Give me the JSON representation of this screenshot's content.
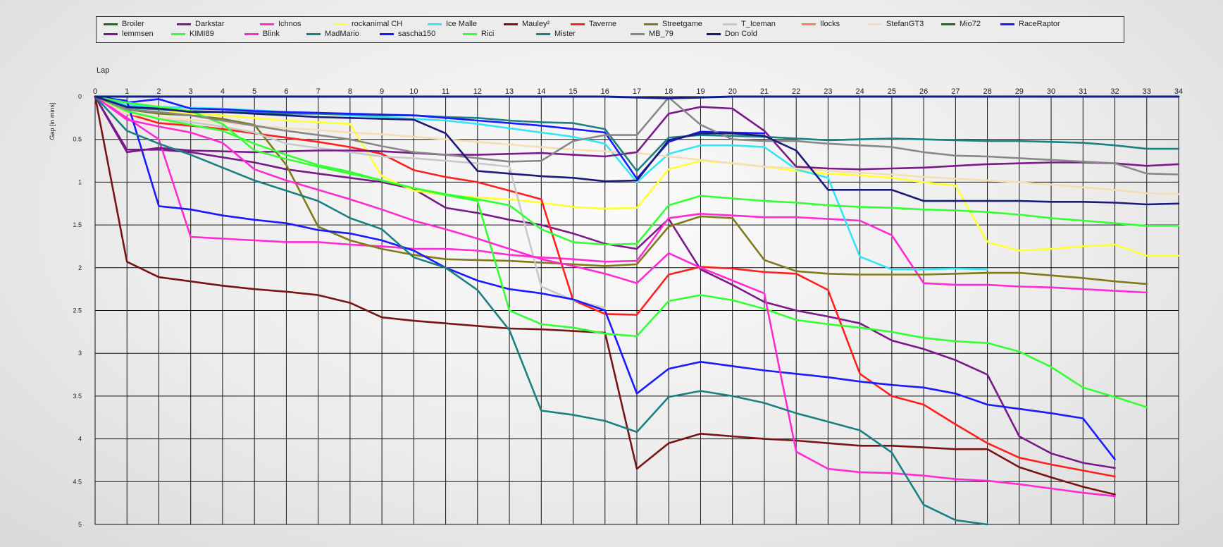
{
  "chart_data": {
    "type": "line",
    "xlabel": "Lap",
    "ylabel": "Gap [in mins]",
    "x": [
      0,
      1,
      2,
      3,
      4,
      5,
      6,
      7,
      8,
      9,
      10,
      11,
      12,
      13,
      14,
      15,
      16,
      17,
      18,
      19,
      20,
      21,
      22,
      23,
      24,
      25,
      26,
      27,
      28,
      29,
      30,
      31,
      32,
      33,
      34
    ],
    "xlim": [
      0,
      34
    ],
    "ylim": [
      0,
      5
    ],
    "y_inverted": true,
    "y_ticks": [
      0,
      0.5,
      1,
      1.5,
      2,
      2.5,
      3,
      3.5,
      4,
      4.5,
      5
    ],
    "grid": true,
    "legend_position": "top",
    "series": [
      {
        "name": "Broiler",
        "color": "#1a6b1a",
        "values": [
          0
        ]
      },
      {
        "name": "Darkstar",
        "color": "#7a1a8a",
        "values": [
          0,
          0.62,
          0.62,
          0.65,
          0.71,
          0.77,
          0.85,
          0.9,
          0.95,
          1.0,
          1.08,
          1.3,
          1.36,
          1.44,
          1.5,
          1.6,
          1.72,
          1.78,
          1.43,
          2.02,
          2.2,
          2.4,
          2.5,
          2.57,
          2.65,
          2.85,
          2.95,
          3.08,
          3.25,
          3.97,
          4.17,
          4.28,
          4.34
        ]
      },
      {
        "name": "Ichnos",
        "color": "#ff2ad4",
        "values": [
          0,
          0.25,
          0.5,
          1.64,
          1.66,
          1.68,
          1.7,
          1.7,
          1.73,
          1.75,
          1.78,
          1.78,
          1.8,
          1.85,
          1.88,
          1.9,
          1.93,
          1.92,
          1.42,
          1.37,
          1.39,
          1.41,
          1.41,
          1.43,
          1.45,
          1.62,
          2.18,
          2.2,
          2.2,
          2.22,
          2.23,
          2.25,
          2.27,
          2.29
        ]
      },
      {
        "name": "rockanimal CH",
        "color": "#ffff33",
        "values": [
          0,
          0.12,
          0.15,
          0.2,
          0.22,
          0.25,
          0.28,
          0.3,
          0.32,
          0.93,
          1.1,
          1.15,
          1.18,
          1.2,
          1.24,
          1.29,
          1.31,
          1.3,
          0.85,
          0.75,
          0.78,
          0.82,
          0.87,
          0.9,
          0.92,
          0.95,
          1.0,
          1.04,
          1.7,
          1.8,
          1.78,
          1.75,
          1.73,
          1.86,
          1.86
        ]
      },
      {
        "name": "Ice Malle",
        "color": "#33e5f5",
        "values": [
          0,
          0.1,
          0.12,
          0.13,
          0.14,
          0.16,
          0.18,
          0.2,
          0.22,
          0.24,
          0.26,
          0.28,
          0.32,
          0.37,
          0.42,
          0.47,
          0.55,
          1.0,
          0.67,
          0.57,
          0.57,
          0.59,
          0.85,
          0.95,
          1.87,
          2.02,
          2.02,
          2.01,
          2.02
        ]
      },
      {
        "name": "Mauley²",
        "color": "#7a1414",
        "values": [
          0,
          1.93,
          2.11,
          2.16,
          2.21,
          2.25,
          2.28,
          2.32,
          2.41,
          2.58,
          2.62,
          2.65,
          2.68,
          2.71,
          2.72,
          2.74,
          2.76,
          4.35,
          4.05,
          3.94,
          3.97,
          4.0,
          4.02,
          4.05,
          4.08,
          4.08,
          4.1,
          4.12,
          4.12,
          4.33,
          4.45,
          4.56,
          4.65
        ]
      },
      {
        "name": "Taverne",
        "color": "#ff1f1f",
        "values": [
          0,
          0.2,
          0.31,
          0.34,
          0.38,
          0.43,
          0.48,
          0.53,
          0.59,
          0.67,
          0.86,
          0.94,
          1.0,
          1.1,
          1.2,
          2.38,
          2.54,
          2.55,
          2.08,
          1.99,
          2.01,
          2.05,
          2.07,
          2.26,
          3.24,
          3.5,
          3.6,
          3.83,
          4.05,
          4.22,
          4.3,
          4.37,
          4.44
        ]
      },
      {
        "name": "Streetgame",
        "color": "#807a1a",
        "values": [
          0,
          0.15,
          0.2,
          0.22,
          0.26,
          0.33,
          0.8,
          1.52,
          1.68,
          1.78,
          1.85,
          1.9,
          1.91,
          1.92,
          1.94,
          1.96,
          1.98,
          1.96,
          1.52,
          1.4,
          1.42,
          1.91,
          2.04,
          2.07,
          2.08,
          2.08,
          2.08,
          2.07,
          2.06,
          2.06,
          2.09,
          2.12,
          2.16,
          2.19
        ]
      },
      {
        "name": "T_Iceman",
        "color": "#c8c8c8",
        "values": [
          0,
          0.18,
          0.25,
          0.3,
          0.35,
          0.42,
          0.55,
          0.6,
          0.65,
          0.7,
          0.72,
          0.75,
          0.78,
          0.82,
          2.22,
          2.38,
          2.47
        ]
      },
      {
        "name": "Ilocks",
        "color": "#ff7a5a",
        "values": [
          0
        ]
      },
      {
        "name": "StefanGT3",
        "color": "#f5deb3",
        "values": [
          0,
          0.2,
          0.25,
          0.27,
          0.3,
          0.34,
          0.37,
          0.39,
          0.42,
          0.44,
          0.47,
          0.5,
          0.53,
          0.56,
          0.59,
          0.62,
          0.64,
          0.66,
          0.7,
          0.74,
          0.78,
          0.82,
          0.84,
          0.87,
          0.89,
          0.91,
          0.94,
          0.96,
          0.98,
          1.0,
          1.03,
          1.06,
          1.09,
          1.13,
          1.14
        ]
      },
      {
        "name": "Mio72",
        "color": "#1a6b1a",
        "values": [
          0
        ]
      },
      {
        "name": "RaceRaptor",
        "color": "#1a1aff",
        "values": [
          0,
          0.05,
          1.28,
          1.32,
          1.39,
          1.44,
          1.48,
          1.56,
          1.6,
          1.68,
          1.8,
          2.0,
          2.15,
          2.25,
          2.3,
          2.37,
          2.5,
          3.47,
          3.18,
          3.1,
          3.15,
          3.2,
          3.24,
          3.28,
          3.33,
          3.37,
          3.4,
          3.47,
          3.6,
          3.65,
          3.7,
          3.76,
          4.24
        ]
      },
      {
        "name": "lemmsen",
        "color": "#7a1a8a",
        "values": [
          0,
          0.65,
          0.6,
          0.63,
          0.64,
          0.65,
          0.64,
          0.63,
          0.63,
          0.64,
          0.66,
          0.68,
          0.68,
          0.67,
          0.66,
          0.68,
          0.7,
          0.65,
          0.2,
          0.12,
          0.14,
          0.4,
          0.82,
          0.84,
          0.85,
          0.84,
          0.83,
          0.81,
          0.79,
          0.78,
          0.77,
          0.77,
          0.78,
          0.81,
          0.79
        ]
      },
      {
        "name": "KIMI89",
        "color": "#33ff33",
        "values": [
          0,
          0.17,
          0.26,
          0.33,
          0.4,
          0.55,
          0.68,
          0.8,
          0.88,
          0.98,
          1.07,
          1.15,
          1.22,
          2.5,
          2.66,
          2.7,
          2.77,
          2.8,
          2.39,
          2.32,
          2.38,
          2.48,
          2.61,
          2.66,
          2.7,
          2.75,
          2.82,
          2.86,
          2.88,
          2.98,
          3.16,
          3.4,
          3.51,
          3.63
        ]
      },
      {
        "name": "Blink",
        "color": "#ff2ad4",
        "values": [
          0,
          0.27,
          0.35,
          0.42,
          0.54,
          0.85,
          0.98,
          1.09,
          1.2,
          1.32,
          1.45,
          1.55,
          1.66,
          1.78,
          1.9,
          1.98,
          2.07,
          2.18,
          1.83,
          2.0,
          2.15,
          2.3,
          4.15,
          4.35,
          4.39,
          4.4,
          4.43,
          4.47,
          4.49,
          4.53,
          4.58,
          4.63,
          4.67
        ]
      },
      {
        "name": "MadMario",
        "color": "#1a8080",
        "values": [
          0,
          0.13,
          0.15,
          0.17,
          0.18,
          0.19,
          0.2,
          0.2,
          0.21,
          0.22,
          0.22,
          0.24,
          0.25,
          0.28,
          0.3,
          0.31,
          0.38,
          0.87,
          0.48,
          0.45,
          0.46,
          0.47,
          0.49,
          0.51,
          0.5,
          0.49,
          0.5,
          0.51,
          0.52,
          0.52,
          0.53,
          0.54,
          0.57,
          0.61,
          0.61
        ]
      },
      {
        "name": "sascha150",
        "color": "#1a1aff",
        "values": [
          0,
          0.07,
          0.03,
          0.14,
          0.15,
          0.17,
          0.18,
          0.19,
          0.2,
          0.21,
          0.22,
          0.25,
          0.28,
          0.31,
          0.34,
          0.38,
          0.42,
          0.96,
          0.53,
          0.41,
          0.42,
          0.43
        ]
      },
      {
        "name": "Rici",
        "color": "#33ff33",
        "values": [
          0,
          0.07,
          0.12,
          0.17,
          0.32,
          0.63,
          0.73,
          0.82,
          0.9,
          0.98,
          1.07,
          1.14,
          1.2,
          1.27,
          1.55,
          1.7,
          1.73,
          1.72,
          1.27,
          1.16,
          1.19,
          1.22,
          1.24,
          1.27,
          1.29,
          1.3,
          1.32,
          1.33,
          1.35,
          1.38,
          1.42,
          1.45,
          1.48,
          1.51,
          1.51
        ]
      },
      {
        "name": "Mister",
        "color": "#1a8080",
        "values": [
          0,
          0.4,
          0.55,
          0.68,
          0.83,
          0.98,
          1.1,
          1.22,
          1.42,
          1.55,
          1.88,
          2.0,
          2.26,
          2.73,
          3.67,
          3.72,
          3.79,
          3.92,
          3.51,
          3.44,
          3.5,
          3.58,
          3.7,
          3.8,
          3.9,
          4.16,
          4.77,
          4.95,
          5.0
        ]
      },
      {
        "name": "MB_79",
        "color": "#888888",
        "values": [
          0,
          0.15,
          0.18,
          0.22,
          0.28,
          0.34,
          0.4,
          0.45,
          0.5,
          0.58,
          0.65,
          0.68,
          0.72,
          0.76,
          0.75,
          0.52,
          0.45,
          0.45,
          0.01,
          0.33,
          0.5,
          0.52,
          0.52,
          0.55,
          0.57,
          0.59,
          0.65,
          0.69,
          0.7,
          0.72,
          0.74,
          0.76,
          0.78,
          0.9,
          0.91
        ]
      },
      {
        "name": "Don Cold",
        "color": "#1a1a7a",
        "values": [
          0,
          0.12,
          0.14,
          0.18,
          0.18,
          0.2,
          0.22,
          0.24,
          0.25,
          0.26,
          0.27,
          0.43,
          0.87,
          0.9,
          0.93,
          0.95,
          0.99,
          0.98,
          0.51,
          0.43,
          0.43,
          0.46,
          0.63,
          1.09,
          1.09,
          1.09,
          1.22,
          1.22,
          1.22,
          1.22,
          1.23,
          1.23,
          1.24,
          1.26,
          1.25
        ]
      },
      {
        "name": "",
        "color": "#0f1f8a",
        "values": [
          0,
          0,
          0,
          0,
          0,
          0,
          0,
          0,
          0,
          0,
          0,
          0,
          0,
          0,
          0,
          0,
          0,
          0.01,
          0.02,
          0.01,
          0,
          0,
          0,
          0,
          0,
          0,
          0,
          0,
          0,
          0,
          0,
          0,
          0,
          0,
          0
        ]
      }
    ]
  }
}
